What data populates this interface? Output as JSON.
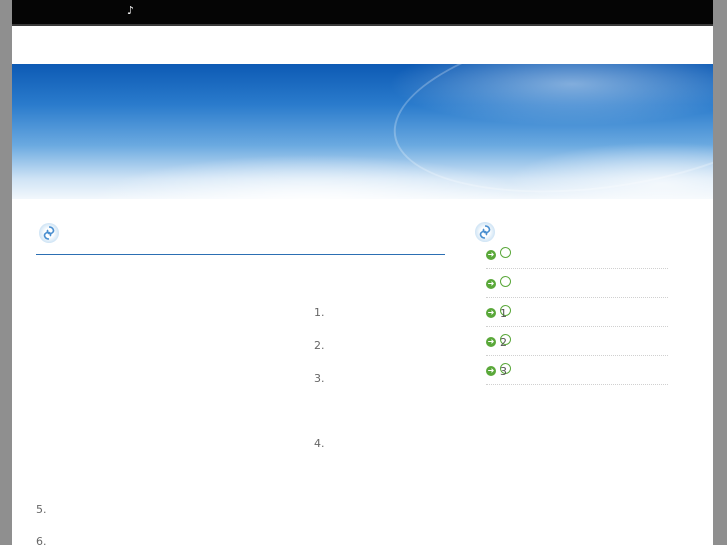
{
  "top_bar": {
    "music_icon": "♪"
  },
  "banner": {
    "title": ""
  },
  "main": {
    "section_title": "",
    "lines": [
      "",
      "1.",
      "2.",
      "3.",
      "",
      "4.",
      "",
      "5.",
      "6."
    ]
  },
  "sidebar": {
    "title": "",
    "items": [
      {
        "label": ""
      },
      {
        "label": ""
      },
      {
        "label": " 1"
      },
      {
        "label": " 2"
      },
      {
        "label": " 3"
      }
    ]
  },
  "colors": {
    "accent": "#1a5a9a",
    "rule": "#2c6fb3",
    "link_arrow": "#5aa83a",
    "frame": "#8f8f8f",
    "top_bar": "#050505"
  }
}
